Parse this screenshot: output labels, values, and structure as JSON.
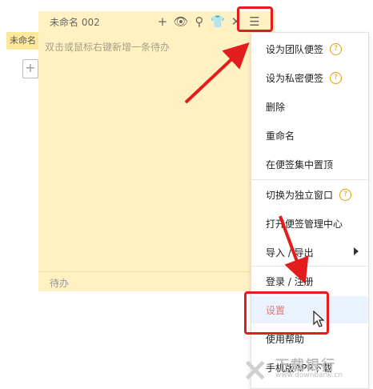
{
  "background_tab": {
    "label": "未命名"
  },
  "background_add": {
    "symbol": "+"
  },
  "note": {
    "title": "未命名 002",
    "placeholder": "双击或鼠标右键新增一条待办",
    "footer": "待办",
    "toolbar": [
      {
        "icon": "plus-icon",
        "glyph": "+"
      },
      {
        "icon": "eye-icon",
        "glyph": "👁"
      },
      {
        "icon": "pin-icon",
        "glyph": "⚲"
      },
      {
        "icon": "shirt-icon",
        "glyph": "👕"
      },
      {
        "icon": "close-icon",
        "glyph": "✕"
      },
      {
        "icon": "menu-icon",
        "glyph": "☰"
      }
    ]
  },
  "menu": {
    "items": [
      {
        "label": "设为团队便签",
        "help": "?"
      },
      {
        "label": "设为私密便签",
        "help": "?"
      },
      {
        "label": "删除"
      },
      {
        "label": "重命名"
      },
      {
        "label": "在便签集中置顶"
      },
      {
        "label": "切换为独立窗口",
        "help": "?"
      },
      {
        "label": "打开便签管理中心"
      },
      {
        "label": "导入 / 导出",
        "submenu": true
      },
      {
        "label": "登录 / 注册"
      },
      {
        "label": "设置",
        "active": true
      },
      {
        "label": "使用帮助"
      },
      {
        "label": "手机版APP下载"
      }
    ]
  },
  "watermark": {
    "logo": "⨯",
    "name": "下载银行",
    "url": "www.downbank.cn"
  },
  "colors": {
    "note_bg": "#fff1c2",
    "highlight": "#e31d1d",
    "active_bg": "#eaf2fd"
  }
}
